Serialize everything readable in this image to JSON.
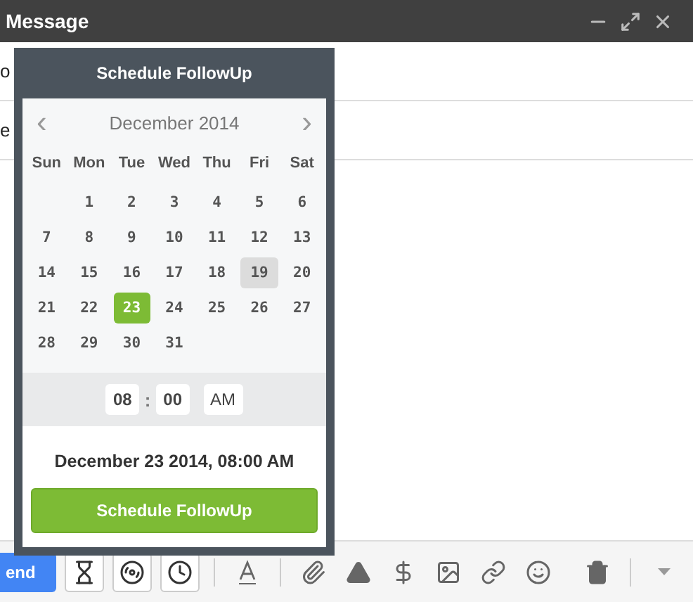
{
  "window": {
    "title": "Message"
  },
  "fields": [
    {
      "label": "o"
    },
    {
      "label": "e"
    }
  ],
  "scheduler": {
    "title": "Schedule FollowUp",
    "month": "December 2014",
    "prev": "‹",
    "next": "›",
    "weekdays": [
      "Sun",
      "Mon",
      "Tue",
      "Wed",
      "Thu",
      "Fri",
      "Sat"
    ],
    "weeks": [
      [
        {
          "day": "1",
          "selected": false,
          "today": false
        },
        {
          "day": "2",
          "selected": false,
          "today": false
        },
        {
          "day": "3",
          "selected": false,
          "today": false
        },
        {
          "day": "4",
          "selected": false,
          "today": false
        },
        {
          "day": "5",
          "selected": false,
          "today": false
        },
        {
          "day": "6",
          "selected": false,
          "today": false
        }
      ],
      [
        {
          "day": "7",
          "selected": false,
          "today": false
        },
        {
          "day": "8",
          "selected": false,
          "today": false
        },
        {
          "day": "9",
          "selected": false,
          "today": false
        },
        {
          "day": "10",
          "selected": false,
          "today": false
        },
        {
          "day": "11",
          "selected": false,
          "today": false
        },
        {
          "day": "12",
          "selected": false,
          "today": false
        },
        {
          "day": "13",
          "selected": false,
          "today": false
        }
      ],
      [
        {
          "day": "14",
          "selected": false,
          "today": false
        },
        {
          "day": "15",
          "selected": false,
          "today": false
        },
        {
          "day": "16",
          "selected": false,
          "today": false
        },
        {
          "day": "17",
          "selected": false,
          "today": false
        },
        {
          "day": "18",
          "selected": false,
          "today": false
        },
        {
          "day": "19",
          "selected": false,
          "today": true
        },
        {
          "day": "20",
          "selected": false,
          "today": false
        }
      ],
      [
        {
          "day": "21",
          "selected": false,
          "today": false
        },
        {
          "day": "22",
          "selected": false,
          "today": false
        },
        {
          "day": "23",
          "selected": true,
          "today": false
        },
        {
          "day": "24",
          "selected": false,
          "today": false
        },
        {
          "day": "25",
          "selected": false,
          "today": false
        },
        {
          "day": "26",
          "selected": false,
          "today": false
        },
        {
          "day": "27",
          "selected": false,
          "today": false
        }
      ],
      [
        {
          "day": "28",
          "selected": false,
          "today": false
        },
        {
          "day": "29",
          "selected": false,
          "today": false
        },
        {
          "day": "30",
          "selected": false,
          "today": false
        },
        {
          "day": "31",
          "selected": false,
          "today": false
        }
      ]
    ],
    "time": {
      "hour": "08",
      "separator": ":",
      "minute": "00",
      "period": "AM"
    },
    "summary": "December 23 2014, 08:00 AM",
    "button": "Schedule FollowUp"
  },
  "toolbar": {
    "send": "end"
  }
}
